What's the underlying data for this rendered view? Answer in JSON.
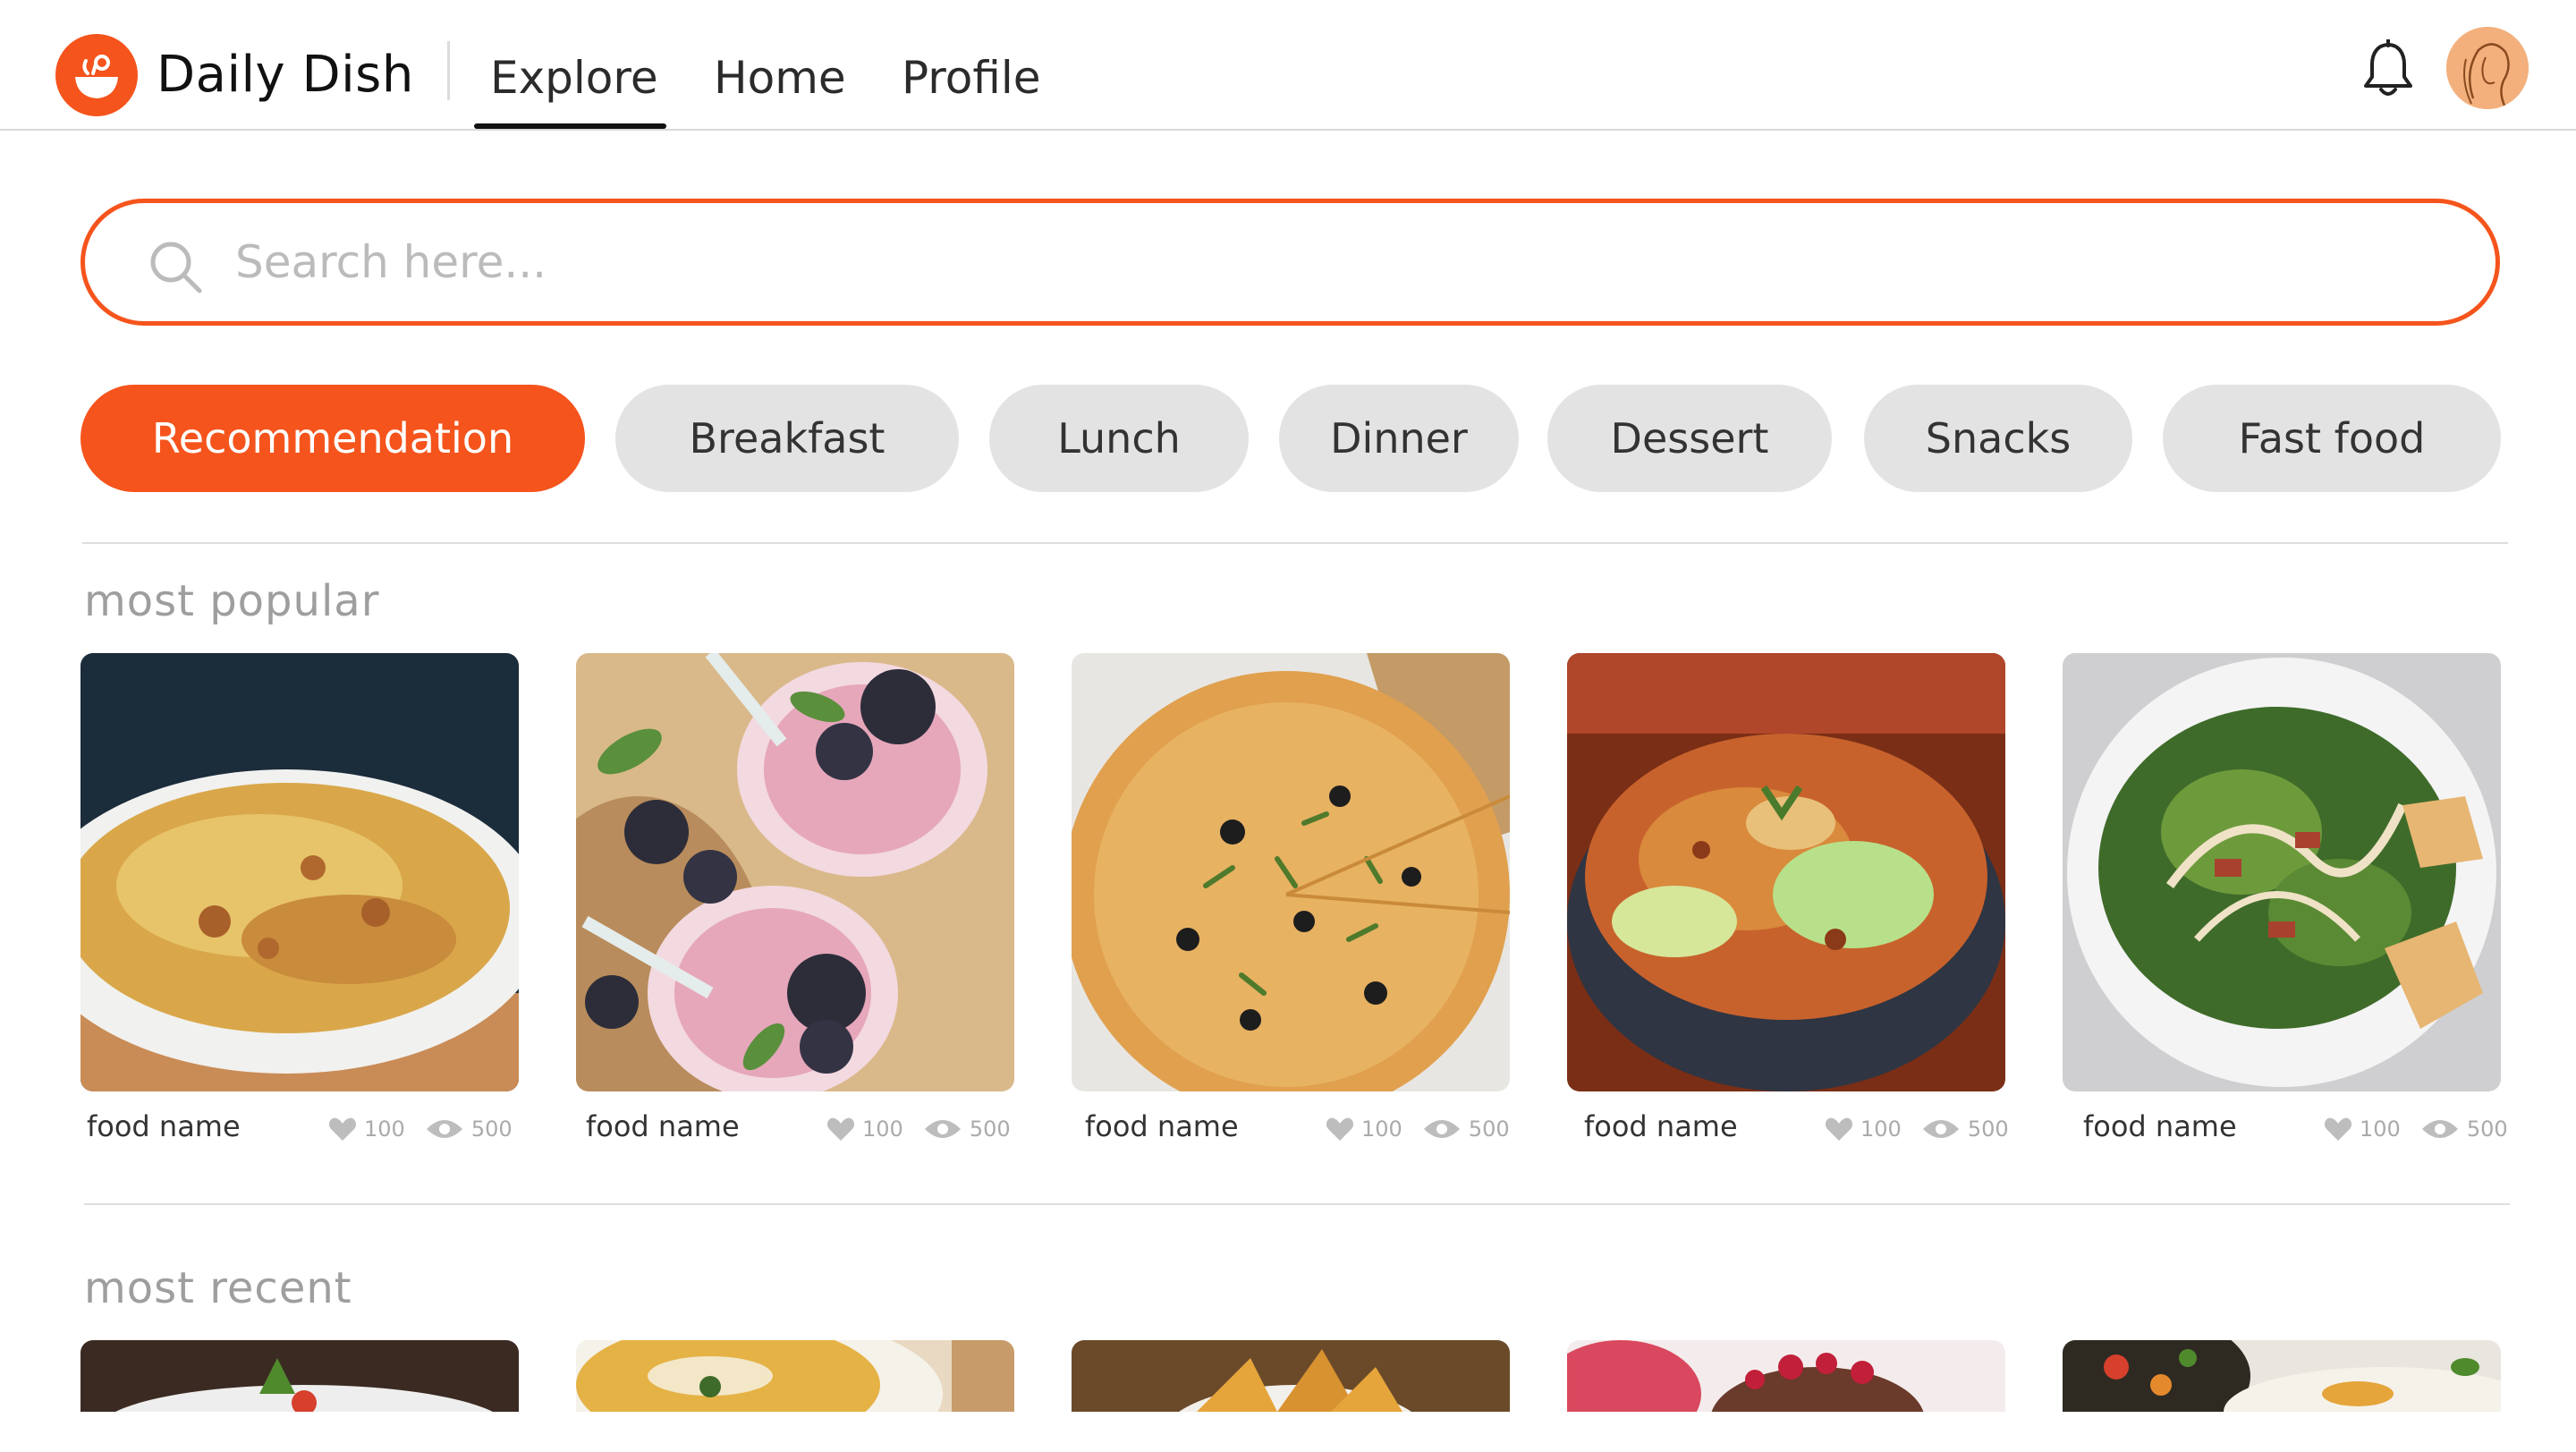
{
  "header": {
    "brand": "Daily Dish",
    "nav": [
      {
        "label": "Explore",
        "active": true
      },
      {
        "label": "Home",
        "active": false
      },
      {
        "label": "Profile",
        "active": false
      }
    ],
    "bell_icon": "bell-icon",
    "avatar_icon": "user-avatar"
  },
  "search": {
    "placeholder": "Search here..."
  },
  "categories": [
    {
      "label": "Recommendation",
      "active": true
    },
    {
      "label": "Breakfast",
      "active": false
    },
    {
      "label": "Lunch",
      "active": false
    },
    {
      "label": "Dinner",
      "active": false
    },
    {
      "label": "Dessert",
      "active": false
    },
    {
      "label": "Snacks",
      "active": false
    },
    {
      "label": "Fast food",
      "active": false
    }
  ],
  "sections": {
    "popular": {
      "title": "most popular",
      "items": [
        {
          "name": "food name",
          "likes": "100",
          "views": "500",
          "image": "baked-pasta"
        },
        {
          "name": "food name",
          "likes": "100",
          "views": "500",
          "image": "berry-smoothie"
        },
        {
          "name": "food name",
          "likes": "100",
          "views": "500",
          "image": "pizza"
        },
        {
          "name": "food name",
          "likes": "100",
          "views": "500",
          "image": "stir-fry-bowl"
        },
        {
          "name": "food name",
          "likes": "100",
          "views": "500",
          "image": "caesar-salad"
        }
      ]
    },
    "recent": {
      "title": "most recent",
      "items": [
        {
          "image": "salad-dish"
        },
        {
          "image": "soup-bowl"
        },
        {
          "image": "potato-wedges"
        },
        {
          "image": "berry-dessert"
        },
        {
          "image": "vegetable-platter"
        }
      ]
    }
  },
  "colors": {
    "accent": "#f5541c",
    "chip_bg": "#e3e3e3",
    "muted_text": "#9e9e9e"
  }
}
